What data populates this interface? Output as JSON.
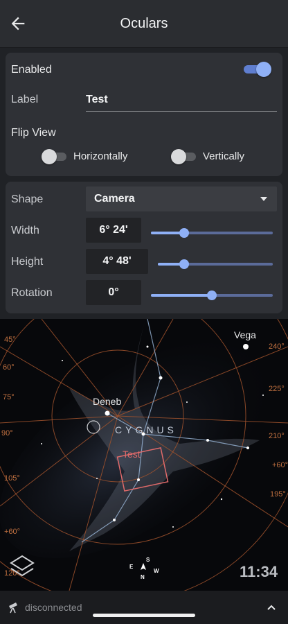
{
  "appbar": {
    "title": "Oculars",
    "back_icon": "arrow-back-icon"
  },
  "general": {
    "enabled_label": "Enabled",
    "enabled": true,
    "label_label": "Label",
    "label_value": "Test",
    "flip_label": "Flip View",
    "flip_horizontal_label": "Horizontally",
    "flip_horizontal": false,
    "flip_vertical_label": "Vertically",
    "flip_vertical": false
  },
  "geometry": {
    "shape_label": "Shape",
    "shape_value": "Camera",
    "width_label": "Width",
    "width_value": "6° 24'",
    "width_level": 0.27,
    "height_label": "Height",
    "height_value": "4° 48'",
    "height_level": 0.23,
    "rotation_label": "Rotation",
    "rotation_value": "0°",
    "rotation_level": 0.5
  },
  "sky": {
    "star_labels": [
      "Vega",
      "Deneb"
    ],
    "constellation": "CYGNUS",
    "ocular_label": "Test",
    "grid_labels": [
      "45°",
      "60°",
      "75°",
      "90°",
      "105°",
      "+60°",
      "120°",
      "240°",
      "225°",
      "210°",
      "+60°",
      "195°"
    ],
    "compass": [
      "E",
      "S",
      "N",
      "W"
    ],
    "time": "11:34"
  },
  "bottom": {
    "status": "disconnected"
  },
  "colors": {
    "accent": "#8fb0f6",
    "grid": "#a0522d",
    "ocular_frame": "#e06a6a",
    "lines": "#9ab6d8"
  }
}
